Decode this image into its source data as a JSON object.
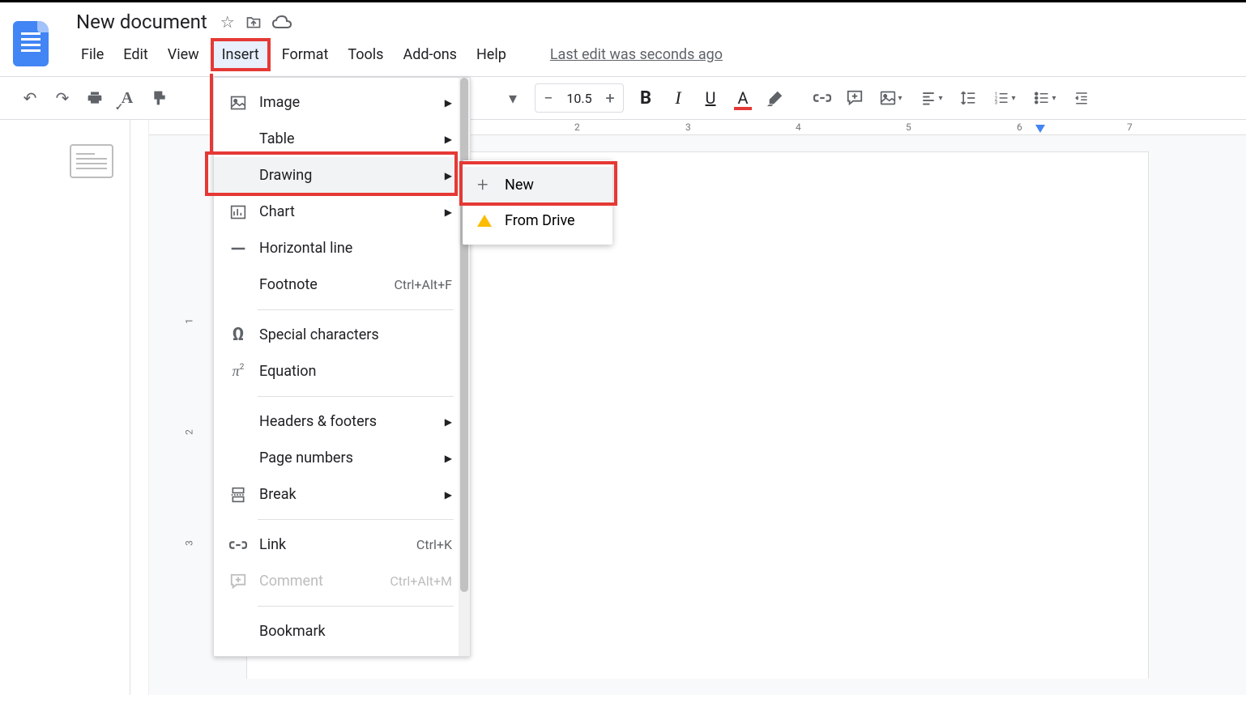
{
  "header": {
    "title": "New document",
    "menus": [
      "File",
      "Edit",
      "View",
      "Insert",
      "Format",
      "Tools",
      "Add-ons",
      "Help"
    ],
    "active_menu_index": 3,
    "last_edit": "Last edit was seconds ago"
  },
  "toolbar": {
    "font_size": "10.5"
  },
  "ruler": {
    "h": [
      "2",
      "3",
      "4",
      "5",
      "6",
      "7"
    ],
    "v": [
      "1",
      "2",
      "3"
    ]
  },
  "insert_menu": [
    {
      "icon": "image",
      "label": "Image",
      "submenu": true
    },
    {
      "icon": "",
      "label": "Table",
      "submenu": true
    },
    {
      "icon": "",
      "label": "Drawing",
      "submenu": true,
      "hover": true,
      "highlight": true
    },
    {
      "icon": "chart",
      "label": "Chart",
      "submenu": true
    },
    {
      "icon": "hline",
      "label": "Horizontal line"
    },
    {
      "icon": "",
      "label": "Footnote",
      "shortcut": "Ctrl+Alt+F"
    },
    {
      "sep": true
    },
    {
      "icon": "omega",
      "label": "Special characters"
    },
    {
      "icon": "pi",
      "label": "Equation"
    },
    {
      "sep": true
    },
    {
      "icon": "",
      "label": "Headers & footers",
      "submenu": true
    },
    {
      "icon": "",
      "label": "Page numbers",
      "submenu": true
    },
    {
      "icon": "break",
      "label": "Break",
      "submenu": true
    },
    {
      "sep": true
    },
    {
      "icon": "link",
      "label": "Link",
      "shortcut": "Ctrl+K"
    },
    {
      "icon": "comment",
      "label": "Comment",
      "shortcut": "Ctrl+Alt+M",
      "disabled": true
    },
    {
      "sep": true
    },
    {
      "icon": "",
      "label": "Bookmark"
    }
  ],
  "drawing_submenu": [
    {
      "icon": "plus",
      "label": "New",
      "hover": true,
      "highlight": true
    },
    {
      "icon": "drive",
      "label": "From Drive"
    }
  ]
}
